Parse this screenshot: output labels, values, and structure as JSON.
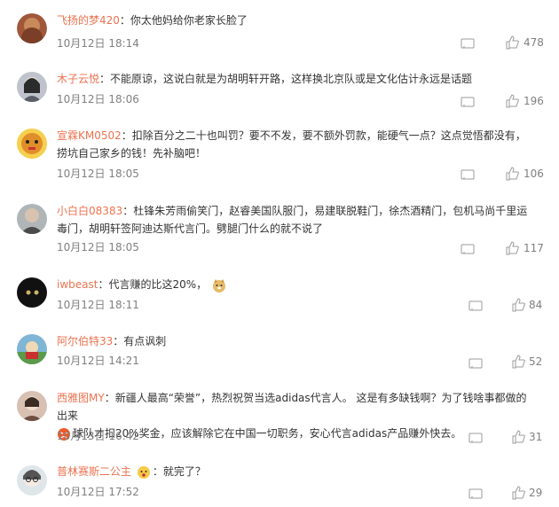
{
  "comments": [
    {
      "user": "飞扬的梦420",
      "text": "你太他妈给你老家长脸了",
      "time": "10月12日 18:14",
      "likes": "478",
      "avatar_color": "#a1583a"
    },
    {
      "user": "木子云悦",
      "text": "不能原谅，这说白就是为胡明轩开路，这样换北京队或是文化估计永远是话题",
      "time": "10月12日 18:06",
      "likes": "196",
      "avatar_color": "#6b6f78"
    },
    {
      "user": "宣霖KM0502",
      "text": "扣除百分之二十也叫罚？要不不发，要不额外罚款，能硬气一点？这点觉悟都没有，捞坑自己家乡的钱！先补脑吧！",
      "time": "10月12日 18:05",
      "likes": "106",
      "avatar_color": "#f1c232"
    },
    {
      "user": "小白白08383",
      "text": "杜锋朱芳雨偷笑门，赵睿美国队服门，易建联脱鞋门，徐杰酒精门，包机马尚千里运毒门，胡明轩签阿迪达斯代言门。劈腿门什么的就不说了",
      "time": "10月12日 18:05",
      "likes": "117",
      "avatar_color": "#9aa3a3"
    },
    {
      "user": "iwbeast",
      "text": "代言赚的比这20%，",
      "time": "10月12日 18:11",
      "likes": "84",
      "avatar_color": "#111111",
      "emoji": "doge-emoji"
    },
    {
      "user": "阿尔伯特33",
      "text": "有点讽刺",
      "time": "10月12日 14:21",
      "likes": "52",
      "avatar_color": "#4e8fb5"
    },
    {
      "user": "西雅图MY",
      "text": "新疆人最高“荣誉”，热烈祝贺当选adidas代言人。 这是有多缺钱啊？为了钱啥事都做的出来",
      "text2": "球队才扣20%奖金，应该解除它在中国一切职务，安心代言adidas产品赚外快去。",
      "time": "10月13日 16:42",
      "likes": "31",
      "avatar_color": "#c4a89a",
      "emoji": "angry-emoji"
    },
    {
      "user": "普林赛斯二公主",
      "text": "就完了？",
      "time": "10月12日 17:52",
      "likes": "29",
      "avatar_color": "#cfd8dc",
      "name_emoji": "surprised-emoji"
    }
  ]
}
